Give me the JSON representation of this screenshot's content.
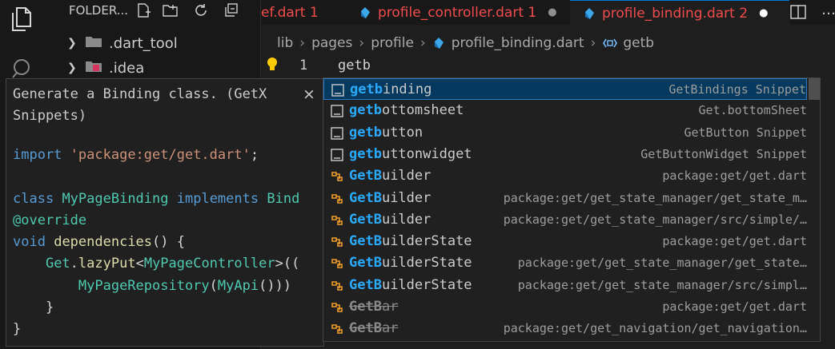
{
  "explorer": {
    "title": "FOLDER...",
    "tree": [
      {
        "label": ".dart_tool"
      },
      {
        "label": ".idea"
      }
    ]
  },
  "tabs": [
    {
      "label": "ef.dart 1"
    },
    {
      "label": "profile_controller.dart 1",
      "modified_dot": "●"
    },
    {
      "label": "profile_binding.dart 2",
      "modified_dot": "●"
    }
  ],
  "breadcrumb": {
    "items": [
      "lib",
      "pages",
      "profile",
      "profile_binding.dart",
      "getb"
    ]
  },
  "editor": {
    "line_number": "1",
    "code": "getb"
  },
  "doc_panel": {
    "title": "Generate a Binding class. (GetX Snippets)",
    "close": "×",
    "code": {
      "l1_kw": "import",
      "l1_str": "'package:get/get.dart'",
      "l1_end": ";",
      "l3_kw": "class",
      "l3_cls": "MyPageBinding",
      "l3_kw2": "implements",
      "l3_cls2": "Bind",
      "l4": "@override",
      "l5_kw": "void",
      "l5_fn": "dependencies",
      "l5_end": "() {",
      "l6_cls": "Get",
      "l6_dot": ".",
      "l6_fn": "lazyPut",
      "l6_lt": "<",
      "l6_cls2": "MyPageController",
      "l6_end": ">((",
      "l7_cls": "MyPageRepository",
      "l7_p": "(",
      "l7_cls2": "MyApi",
      "l7_end": "()))",
      "l8": "}",
      "l9": "}"
    }
  },
  "suggestions": [
    {
      "match": "getb",
      "rest": "inding",
      "detail": "GetBindings Snippet",
      "kind": "snippet"
    },
    {
      "match": "getb",
      "rest": "ottomsheet",
      "detail": "Get.bottomSheet",
      "kind": "snippet"
    },
    {
      "match": "getb",
      "rest": "utton",
      "detail": "GetButton Snippet",
      "kind": "snippet"
    },
    {
      "match": "getb",
      "rest": "uttonwidget",
      "detail": "GetButtonWidget Snippet",
      "kind": "snippet"
    },
    {
      "match": "GetB",
      "rest": "uilder",
      "detail": "package:get/get.dart",
      "kind": "class"
    },
    {
      "match": "GetB",
      "rest": "uilder",
      "detail": "package:get/get_state_manager/get_state_m…",
      "kind": "class"
    },
    {
      "match": "GetB",
      "rest": "uilder",
      "detail": "package:get/get_state_manager/src/simple/…",
      "kind": "class"
    },
    {
      "match": "GetB",
      "rest": "uilderState",
      "detail": "package:get/get.dart",
      "kind": "class"
    },
    {
      "match": "GetB",
      "rest": "uilderState",
      "detail": "package:get/get_state_manager/get_state…",
      "kind": "class"
    },
    {
      "match": "GetB",
      "rest": "uilderState",
      "detail": "package:get/get_state_manager/src/simpl…",
      "kind": "class"
    },
    {
      "match": "GetB",
      "rest": "ar",
      "detail": "package:get/get.dart",
      "kind": "class",
      "deprecated": true
    },
    {
      "match": "GetB",
      "rest": "ar",
      "detail": "package:get/get_navigation/get_navigation…",
      "kind": "class",
      "deprecated": true
    }
  ],
  "colors": {
    "accent": "#0078d4",
    "error": "#f14c4c",
    "match_highlight": "#2aaaff",
    "class_icon": "#ee9d28",
    "selected_row": "#04395e"
  }
}
